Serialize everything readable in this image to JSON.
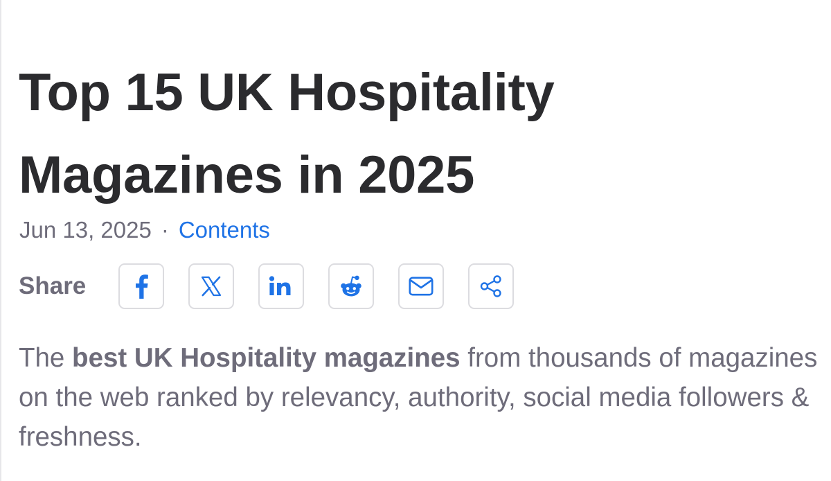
{
  "article": {
    "title": "Top 15 UK Hospitality Magazines in 2025",
    "date": "Jun 13, 2025",
    "separator": "·",
    "contents_link": "Contents"
  },
  "share": {
    "label": "Share",
    "buttons": [
      {
        "icon": "facebook-icon"
      },
      {
        "icon": "x-icon"
      },
      {
        "icon": "linkedin-icon"
      },
      {
        "icon": "reddit-icon"
      },
      {
        "icon": "mail-icon"
      },
      {
        "icon": "share-icon"
      }
    ]
  },
  "intro": {
    "lead": "The ",
    "bold": "best UK Hospitality magazines",
    "rest": " from thousands of magazines on the web ranked by relevancy, authority, social media followers & freshness."
  },
  "colors": {
    "title": "#2b2b2e",
    "muted_text": "#6e6c7a",
    "link": "#1f73e6",
    "button_border": "#dcdce0"
  }
}
